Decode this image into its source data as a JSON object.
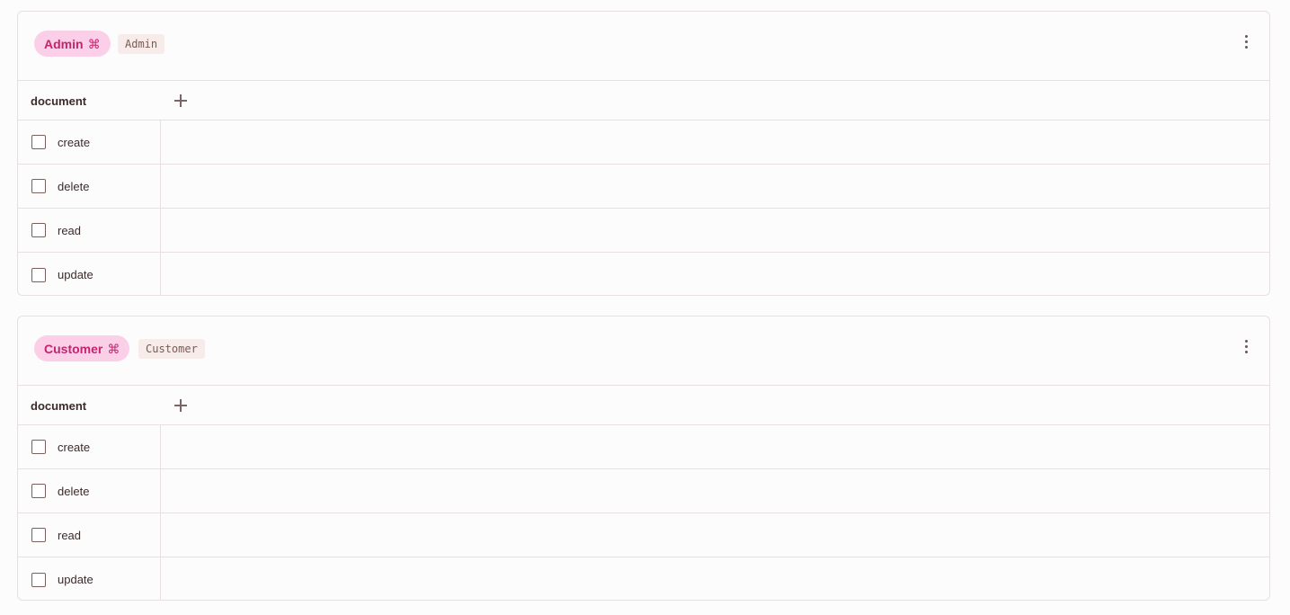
{
  "roles": [
    {
      "name": "Admin",
      "shortcut_icon": "⌘",
      "code": "Admin",
      "resource": "document",
      "actions": [
        "create",
        "delete",
        "read",
        "update"
      ]
    },
    {
      "name": "Customer",
      "shortcut_icon": "⌘",
      "code": "Customer",
      "resource": "document",
      "actions": [
        "create",
        "delete",
        "read",
        "update"
      ]
    }
  ],
  "icons": {
    "more": "more-vertical-icon",
    "add": "plus-icon",
    "checkbox": "checkbox-unchecked-icon"
  },
  "colors": {
    "pill_bg": "#fbcfe8",
    "pill_text": "#c0266f",
    "code_bg": "#f7ece9",
    "border": "#e7dfe2"
  }
}
